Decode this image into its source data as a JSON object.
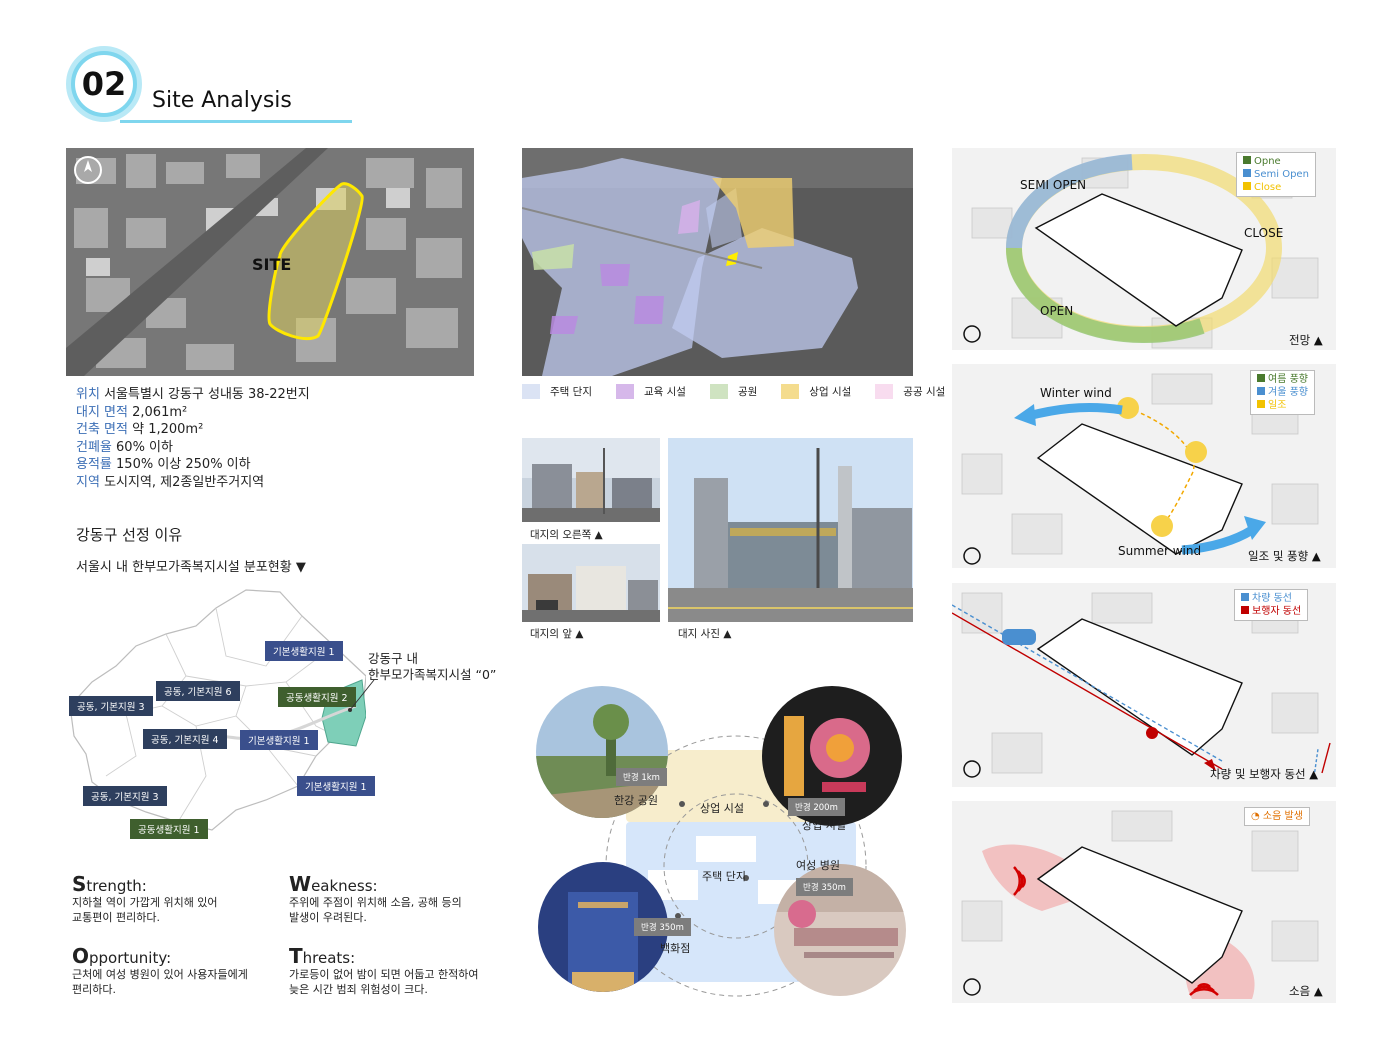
{
  "header": {
    "number": "02",
    "title": "Site Analysis"
  },
  "site_map": {
    "label": "SITE"
  },
  "site_info": [
    {
      "key": "위치",
      "value": "서울특별시 강동구 성내동 38-22번지"
    },
    {
      "key": "대지 면적",
      "value": "2,061m²"
    },
    {
      "key": "건축 면적",
      "value": "약 1,200m²"
    },
    {
      "key": "건폐율",
      "value": "60% 이하"
    },
    {
      "key": "용적률",
      "value": "150% 이상 250% 이하"
    },
    {
      "key": "지역",
      "value": "도시지역, 제2종일반주거지역"
    }
  ],
  "reason_title": "강동구 선정 이유",
  "distribution_title": "서울시 내 한부모가족복지시설 분포현황 ▼",
  "district_labels": {
    "l1": "기본생활지원 1",
    "l2": "공동, 기본지원 6",
    "l3": "공동생활지원 2",
    "l4": "공동, 기본지원 3",
    "l5": "공동, 기본지원 4",
    "l6": "기본생활지원 1",
    "l7": "기본생활지원 1",
    "l8": "공동, 기본지원 3",
    "l9": "공동생활지원 1"
  },
  "gangdong_note": {
    "line1": "강동구 내",
    "line2": "한부모가족복지시설 “0”"
  },
  "swot": {
    "s": {
      "initial": "S",
      "rest": "trength:",
      "text1": "지하철 역이 가깝게 위치해 있어",
      "text2": "교통편이 편리하다."
    },
    "w": {
      "initial": "W",
      "rest": "eakness:",
      "text1": "주위에 주점이 위치해 소음, 공해 등의",
      "text2": "발생이 우려된다."
    },
    "o": {
      "initial": "O",
      "rest": "pportunity:",
      "text1": "근처에 여성 병원이 있어 사용자들에게",
      "text2": "편리하다."
    },
    "t": {
      "initial": "T",
      "rest": "hreats:",
      "text1": "가로등이 없어 밤이 되면 어둡고 한적하여",
      "text2": "늦은 시간 범죄 위험성이 크다."
    }
  },
  "zoning_legend": [
    {
      "label": "주택 단지",
      "color": "#dbe3f4"
    },
    {
      "label": "교육 시설",
      "color": "#d6b8ea"
    },
    {
      "label": "공원",
      "color": "#cfe3c1"
    },
    {
      "label": "상업 시설",
      "color": "#f4dc8e"
    },
    {
      "label": "공공 시설",
      "color": "#f8dcef"
    }
  ],
  "photos": {
    "right": "대지의 오른쪽 ▲",
    "front": "대지의 앞 ▲",
    "site": "대지 사진 ▲"
  },
  "surroundings": {
    "tag_park": "반경 1km",
    "park": "한강 공원",
    "commercial_center": "상업 시설",
    "tag_commercial": "반경 200m",
    "commercial": "상업 시설",
    "hospital": "여성 병원",
    "tag_hospital": "반경 350m",
    "housing": "주택 단지",
    "tag_store": "반경 350m",
    "store": "백화점"
  },
  "diagrams": {
    "view": {
      "legend": [
        "Opne",
        "Semi Open",
        "Close"
      ],
      "legend_colors": [
        "#4a7a2e",
        "#4a8fd0",
        "#f2c200"
      ],
      "semi_open": "SEMI OPEN",
      "close": "CLOSE",
      "open": "OPEN",
      "caption": "전망 ▲"
    },
    "wind": {
      "legend": [
        "여름 풍향",
        "겨울 풍향",
        "일조"
      ],
      "legend_colors": [
        "#4a7a2e",
        "#4a8fd0",
        "#f2c200"
      ],
      "winter": "Winter wind",
      "summer": "Summer wind",
      "caption": "일조 및 풍향 ▲"
    },
    "traffic": {
      "legend": [
        "차량 동선",
        "보행자 동선"
      ],
      "legend_colors": [
        "#4a8fd0",
        "#c00000"
      ],
      "caption": "차량 및 보행자 동선 ▲"
    },
    "noise": {
      "legend": "소음 발생",
      "caption": "소음 ▲"
    }
  }
}
